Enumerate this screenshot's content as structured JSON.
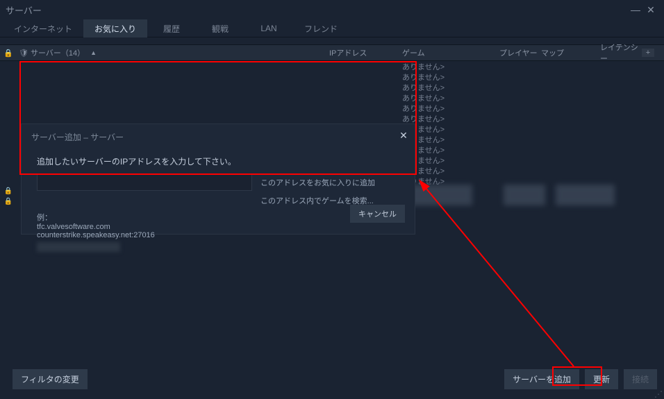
{
  "window": {
    "title": "サーバー"
  },
  "tabs": [
    {
      "label": "インターネット"
    },
    {
      "label": "お気に入り"
    },
    {
      "label": "履歴"
    },
    {
      "label": "観戦"
    },
    {
      "label": "LAN"
    },
    {
      "label": "フレンド"
    }
  ],
  "active_tab_index": 1,
  "columns": {
    "server": "サーバー（14）",
    "ip": "IPアドレス",
    "game": "ゲーム",
    "player": "プレイヤー",
    "map": "マップ",
    "latency": "レイテンシー",
    "sort_arrow": "▲",
    "plus": "+"
  },
  "rows": [
    {
      "game_text": "ありません>"
    },
    {
      "game_text": "ありません>"
    },
    {
      "game_text": "ありません>"
    },
    {
      "game_text": "ありません>"
    },
    {
      "game_text": "ありません>"
    },
    {
      "game_text": "ありません>"
    },
    {
      "game_text": "ありません>"
    },
    {
      "game_text": "ありません>"
    },
    {
      "game_text": "ありません>"
    },
    {
      "game_text": "ありません>"
    },
    {
      "game_text": "ありません>"
    },
    {
      "game_text": "ありません>"
    }
  ],
  "dialog": {
    "title": "サーバー追加 – サーバー",
    "prompt": "追加したいサーバーのIPアドレスを入力して下さい。",
    "input_value": "",
    "add_fav_btn": "このアドレスをお気に入りに追加",
    "search_btn": "このアドレス内でゲームを検索...",
    "example_header": "例：",
    "example_line1": "tfc.valvesoftware.com",
    "example_line2": "counterstrike.speakeasy.net:27016",
    "cancel": "キャンセル"
  },
  "footer": {
    "filter": "フィルタの変更",
    "add_server": "サーバーを追加",
    "refresh": "更新",
    "connect": "接続"
  },
  "icons": {
    "lock": "🔒",
    "shield": "🛡"
  }
}
